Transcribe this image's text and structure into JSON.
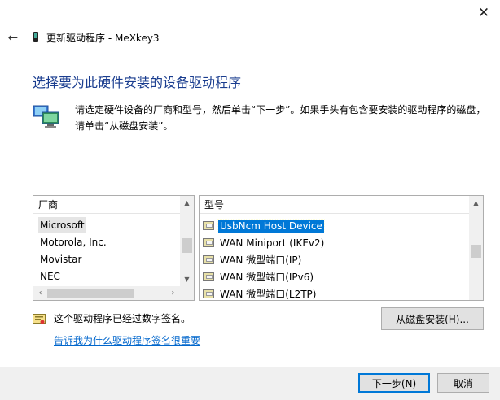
{
  "window": {
    "title": "更新驱动程序 - MeXkey3",
    "close_glyph": "✕",
    "back_glyph": "←"
  },
  "heading": "选择要为此硬件安装的设备驱动程序",
  "instructions": {
    "line1": "请选定硬件设备的厂商和型号，然后单击“下一步”。如果手头有包含要安装的驱动程序的磁盘，",
    "line2": "请单击“从磁盘安装”。"
  },
  "manufacturers": {
    "header": "厂商",
    "items": [
      "Microsoft",
      "Motorola, Inc.",
      "Movistar",
      "NEC"
    ],
    "selected": "Microsoft"
  },
  "models": {
    "header": "型号",
    "items": [
      "UsbNcm Host Device",
      "WAN Miniport (IKEv2)",
      "WAN 微型端口(IP)",
      "WAN 微型端口(IPv6)",
      "WAN 微型端口(L2TP)"
    ],
    "selected": "UsbNcm Host Device"
  },
  "signature": {
    "status_text": "这个驱动程序已经过数字签名。",
    "link_text": "告诉我为什么驱动程序签名很重要"
  },
  "buttons": {
    "have_disk": "从磁盘安装(H)...",
    "next": "下一步(N)",
    "cancel": "取消"
  },
  "colors": {
    "heading": "#1a3d8f",
    "link": "#0066cc",
    "selection": "#0078d7",
    "footer": "#f0f0f0"
  },
  "icons": [
    "close-icon",
    "back-arrow-icon",
    "device-icon",
    "hardware-monitors-icon",
    "driver-package-icon",
    "certificate-icon"
  ]
}
